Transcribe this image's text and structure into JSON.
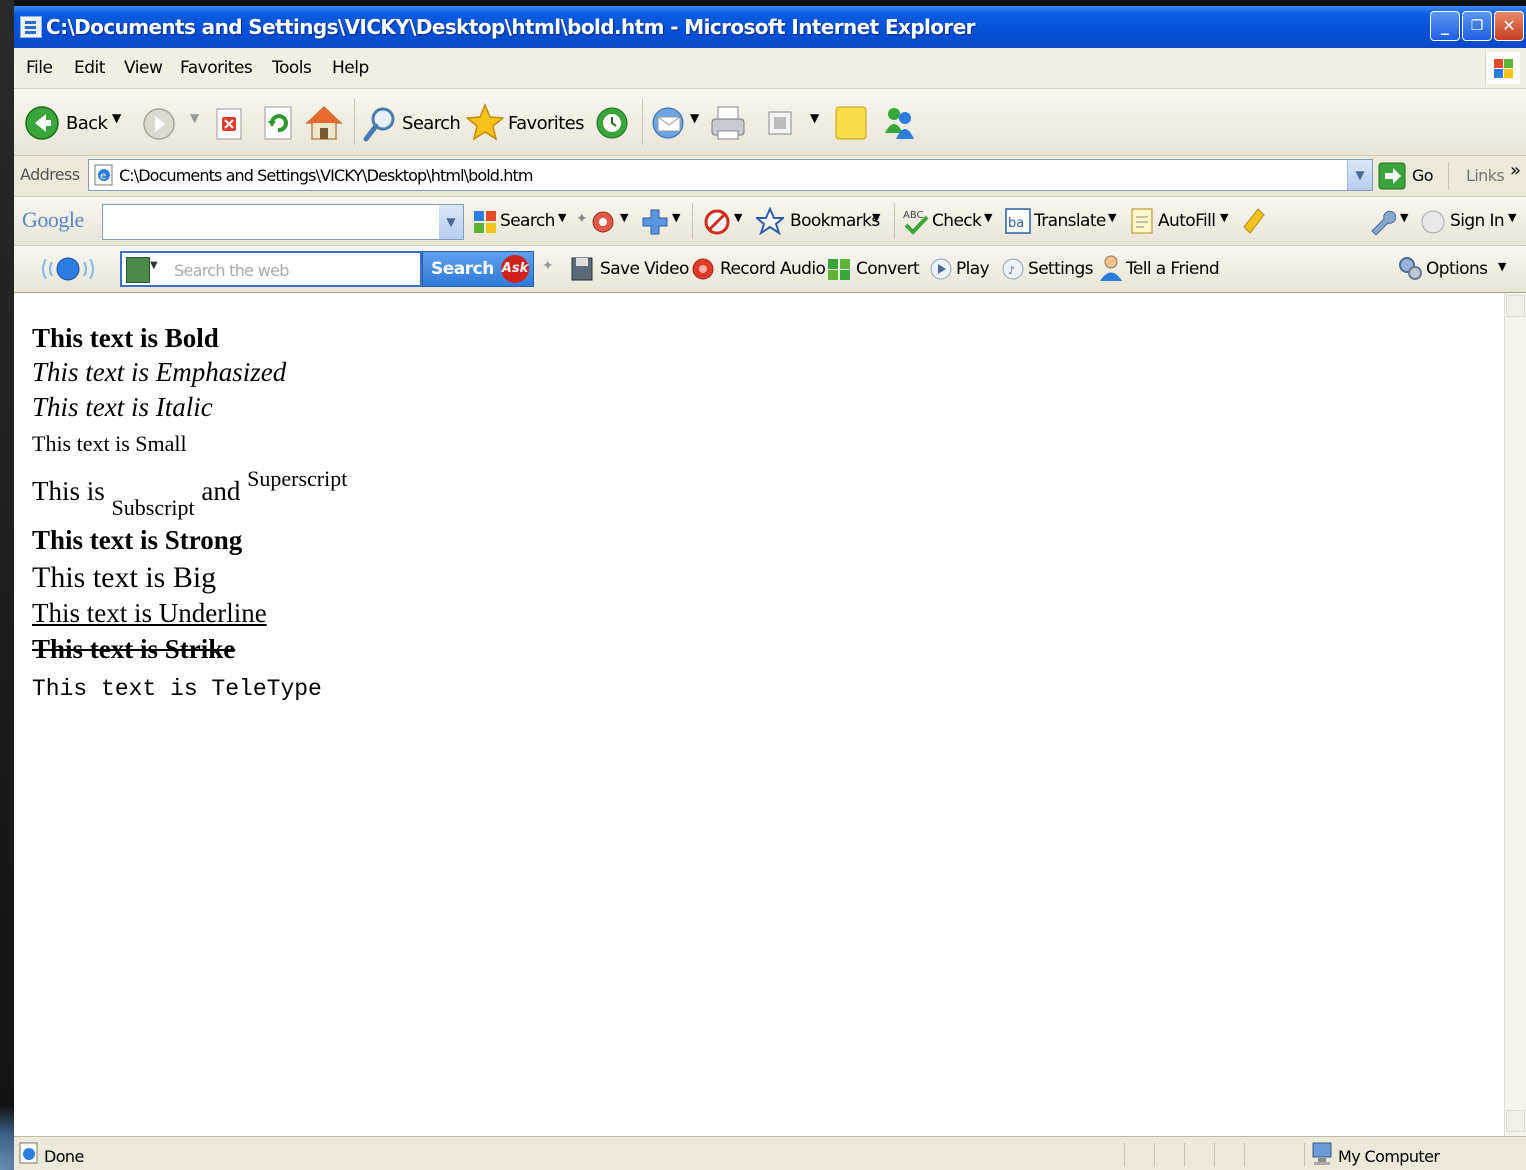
{
  "window": {
    "title": "C:\\Documents and Settings\\VICKY\\Desktop\\html\\bold.htm - Microsoft Internet Explorer",
    "controls": [
      "_",
      "❐",
      "✕"
    ]
  },
  "menu": [
    "File",
    "Edit",
    "View",
    "Favorites",
    "Tools",
    "Help"
  ],
  "toolbar": {
    "back": "Back",
    "search": "Search",
    "favorites": "Favorites"
  },
  "address": {
    "label": "Address",
    "url": "C:\\Documents and Settings\\VICKY\\Desktop\\html\\bold.htm",
    "go": "Go",
    "links": "Links",
    "more": "»"
  },
  "google": {
    "logo": "Google",
    "search": "Search",
    "bookmarks": "Bookmarks",
    "check": "Check",
    "translate": "Translate",
    "autofill": "AutoFill",
    "sign_in": "Sign In"
  },
  "ask": {
    "placeholder": "Search the web",
    "search_button": "Search",
    "ask_logo": "Ask",
    "save_video": "Save Video",
    "record_audio": "Record Audio",
    "convert": "Convert",
    "play": "Play",
    "settings": "Settings",
    "tell_friend": "Tell a Friend",
    "options": "Options"
  },
  "content": {
    "bold": "This text is Bold",
    "emphasized": "This text is Emphasized",
    "italic": "This text is Italic",
    "small": "This text is Small",
    "this_is": "This is",
    "subscript": "Subscript",
    "and": "and",
    "superscript": "Superscript",
    "strong": "This text is Strong",
    "big": "This text is Big",
    "underline": "This text is Underline",
    "strike": "This text is Strike",
    "teletype": "This text is TeleType"
  },
  "status": {
    "done": "Done",
    "zone": "My Computer"
  },
  "colors": {
    "titlebar": "#0450d6",
    "chrome": "#ece9d8",
    "ask_blue": "#2f7bd8",
    "ask_red": "#d0221b"
  }
}
